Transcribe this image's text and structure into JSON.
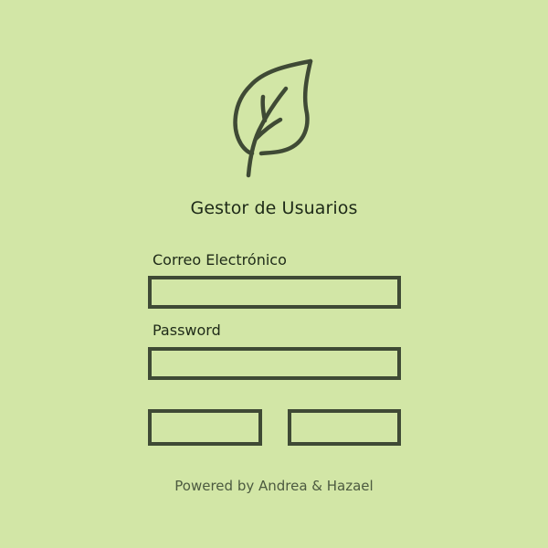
{
  "app": {
    "title": "Gestor de Usuarios",
    "logo_icon": "leaf-icon"
  },
  "form": {
    "email": {
      "label": "Correo Electrónico",
      "value": "",
      "placeholder": ""
    },
    "password": {
      "label": "Password",
      "value": "",
      "placeholder": ""
    },
    "buttons": {
      "left_label": "",
      "right_label": ""
    }
  },
  "footer": {
    "text": "Powered by Andrea & Hazael"
  },
  "colors": {
    "background": "#d2e6a6",
    "border": "#3f4a35",
    "icon": "#3f4a35",
    "text": "#1e2a18",
    "footer_text": "#4c5a40"
  }
}
